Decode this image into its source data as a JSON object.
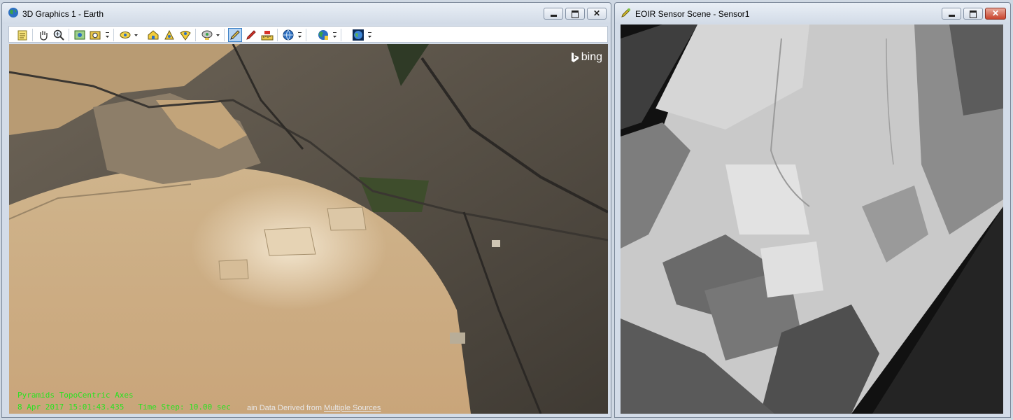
{
  "windows": {
    "graphics": {
      "title": "3D Graphics 1 - Earth",
      "toolbar_icons": [
        "properties-icon",
        "pan-hand-icon",
        "zoom-icon",
        "map-view-icon",
        "camera-icon",
        "view-from-icon",
        "home-view-icon",
        "zoom-to-icon",
        "orient-icon",
        "measure-icon",
        "pencil-icon",
        "red-pen-icon",
        "ruler-icon",
        "globe-icon",
        "globe-terrain-icon",
        "earth-image-icon"
      ],
      "viewport": {
        "bing_label": "bing",
        "overlay_line1": "Pyramids TopoCentric Axes",
        "overlay_date": "8 Apr 2017 15:01:43.435",
        "overlay_timestep": "Time Step: 10.00 sec",
        "credit_prefix": "ain Data Derived from ",
        "credit_link": "Multiple Sources"
      }
    },
    "sensor": {
      "title": "EOIR Sensor Scene - Sensor1"
    }
  },
  "colors": {
    "overlay_text": "#27e31f",
    "title_bar": "#dce4ee",
    "close_button": "#c8432c"
  }
}
